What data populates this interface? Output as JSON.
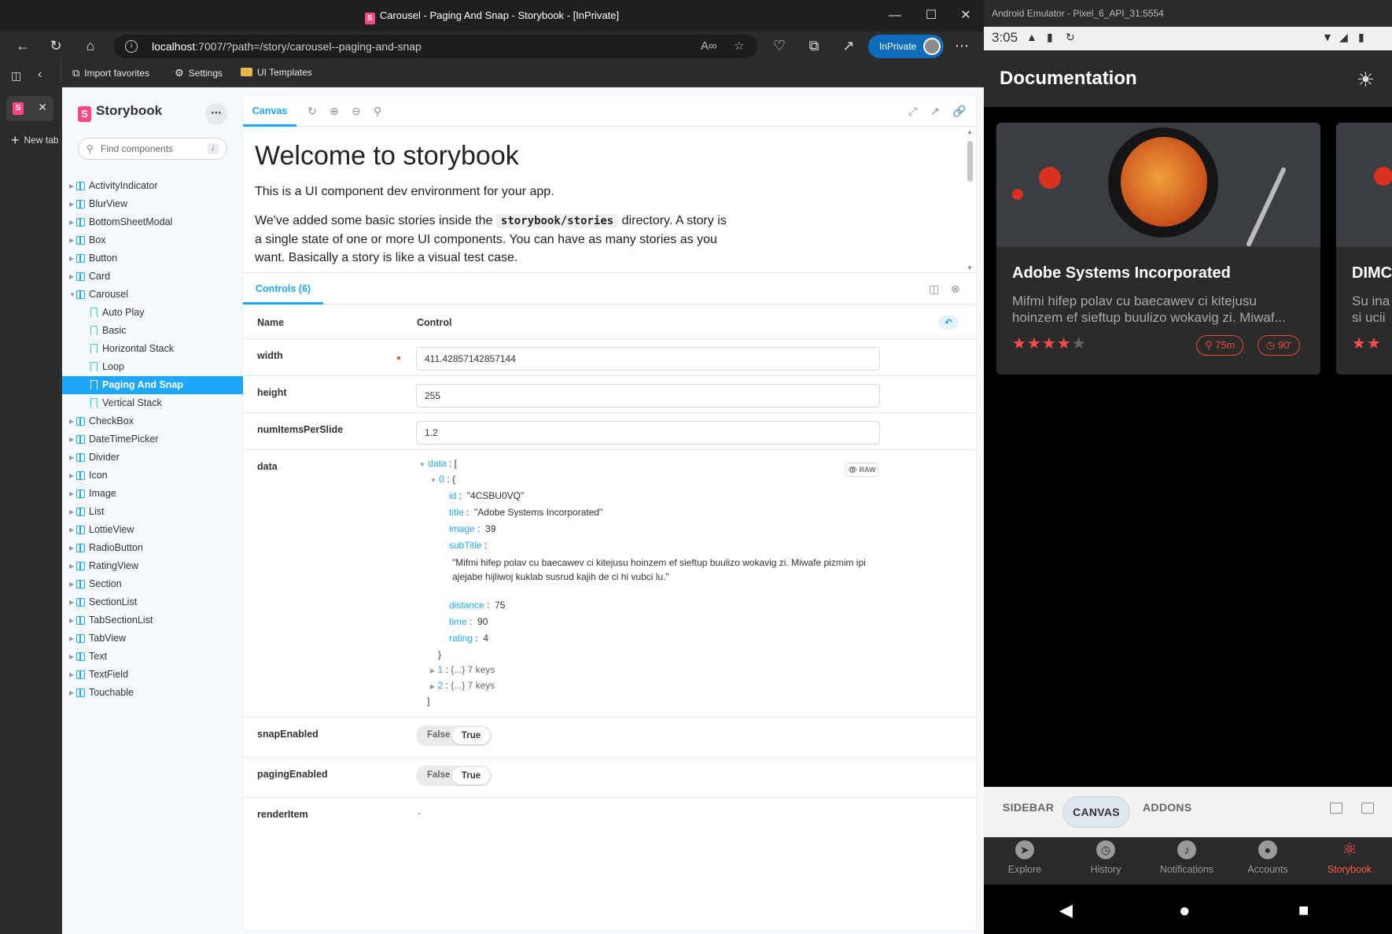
{
  "browser": {
    "window_title": "Carousel - Paging And Snap - Storybook - [InPrivate]",
    "address": {
      "host": "localhost",
      "path": ":7007/?path=/story/carousel--paging-and-snap"
    },
    "inprivate_label": "InPrivate",
    "favorites": [
      "Import favorites",
      "Settings",
      "UI Templates"
    ],
    "new_tab_label": "New tab"
  },
  "storybook": {
    "brand": "Storybook",
    "search_placeholder": "Find components",
    "search_shortcut": "/",
    "tree": [
      {
        "label": "ActivityIndicator",
        "type": "component"
      },
      {
        "label": "BlurView",
        "type": "component"
      },
      {
        "label": "BottomSheetModal",
        "type": "component"
      },
      {
        "label": "Box",
        "type": "component"
      },
      {
        "label": "Button",
        "type": "component"
      },
      {
        "label": "Card",
        "type": "component"
      },
      {
        "label": "Carousel",
        "type": "component",
        "expanded": true
      },
      {
        "label": "Auto Play",
        "type": "story"
      },
      {
        "label": "Basic",
        "type": "story"
      },
      {
        "label": "Horizontal Stack",
        "type": "story"
      },
      {
        "label": "Loop",
        "type": "story"
      },
      {
        "label": "Paging And Snap",
        "type": "story",
        "selected": true
      },
      {
        "label": "Vertical Stack",
        "type": "story"
      },
      {
        "label": "CheckBox",
        "type": "component"
      },
      {
        "label": "DateTimePicker",
        "type": "component"
      },
      {
        "label": "Divider",
        "type": "component"
      },
      {
        "label": "Icon",
        "type": "component"
      },
      {
        "label": "Image",
        "type": "component"
      },
      {
        "label": "List",
        "type": "component"
      },
      {
        "label": "LottieView",
        "type": "component"
      },
      {
        "label": "RadioButton",
        "type": "component"
      },
      {
        "label": "RatingView",
        "type": "component"
      },
      {
        "label": "Section",
        "type": "component"
      },
      {
        "label": "SectionList",
        "type": "component"
      },
      {
        "label": "TabSectionList",
        "type": "component"
      },
      {
        "label": "TabView",
        "type": "component"
      },
      {
        "label": "Text",
        "type": "component"
      },
      {
        "label": "TextField",
        "type": "component"
      },
      {
        "label": "Touchable",
        "type": "component"
      }
    ],
    "canvas_tab": "Canvas",
    "canvas": {
      "heading": "Welcome to storybook",
      "p1": "This is a UI component dev environment for your app.",
      "p2_before": "We've added some basic stories inside the ",
      "p2_code": "storybook/stories",
      "p2_after": " directory. A story is a single state of one or more UI components. You can have as many stories as you want. Basically a story is like a visual test case."
    },
    "controls_tab": "Controls (6)",
    "table_headers": {
      "name": "Name",
      "control": "Control"
    },
    "controls": {
      "width": {
        "label": "width",
        "value": "411.42857142857144"
      },
      "height": {
        "label": "height",
        "value": "255"
      },
      "numItemsPerSlide": {
        "label": "numItemsPerSlide",
        "value": "1.2"
      },
      "data": {
        "label": "data",
        "raw_label": "RAW",
        "root_key": "data",
        "item0_key": "0",
        "id_key": "id",
        "id": "\"4CSBU0VQ\"",
        "title_key": "title",
        "title": "\"Adobe Systems Incorporated\"",
        "image_key": "image",
        "image": "39",
        "subTitle_key": "subTitle",
        "subTitle": "\"Mifmi hifep polav cu baecawev ci kitejusu hoinzem ef sieftup buulizo wokavig zi. Miwafe pizmim ipi ajejabe hijliwoj kuklab susrud kajih de ci hi vubci lu.\"",
        "distance_key": "distance",
        "distance": "75",
        "time_key": "time",
        "time": "90",
        "rating_key": "rating",
        "rating": "4",
        "item1_key": "1",
        "item1_summary": "{...} 7 keys",
        "item2_key": "2",
        "item2_summary": "{...} 7 keys"
      },
      "snapEnabled": {
        "label": "snapEnabled",
        "false_label": "False",
        "true_label": "True",
        "value": true
      },
      "pagingEnabled": {
        "label": "pagingEnabled",
        "false_label": "False",
        "true_label": "True",
        "value": true
      },
      "renderItem": {
        "label": "renderItem",
        "value": "-"
      }
    }
  },
  "emulator": {
    "window_title": "Android Emulator - Pixel_6_API_31:5554",
    "time": "3:05",
    "app_title": "Documentation",
    "cards": [
      {
        "title": "Adobe Systems Incorporated",
        "subtitle": "Mifmi hifep polav cu baecawev ci kitejusu hoinzem ef sieftup buulizo wokavig zi. Miwaf...",
        "rating": 4,
        "rating_max": 5,
        "distance": "75m",
        "time": "90'"
      },
      {
        "title": "DIMC",
        "subtitle": "Su ina si ucii"
      }
    ],
    "storybook_tabs": [
      "SIDEBAR",
      "CANVAS",
      "ADDONS"
    ],
    "active_sb_tab": "CANVAS",
    "nav": [
      "Explore",
      "History",
      "Notifications",
      "Accounts",
      "Storybook"
    ],
    "active_nav": "Storybook",
    "colors": {
      "accent": "#ff5a4a",
      "storybook_blue": "#1ea7fd",
      "storybook_pink": "#ff4785"
    }
  }
}
